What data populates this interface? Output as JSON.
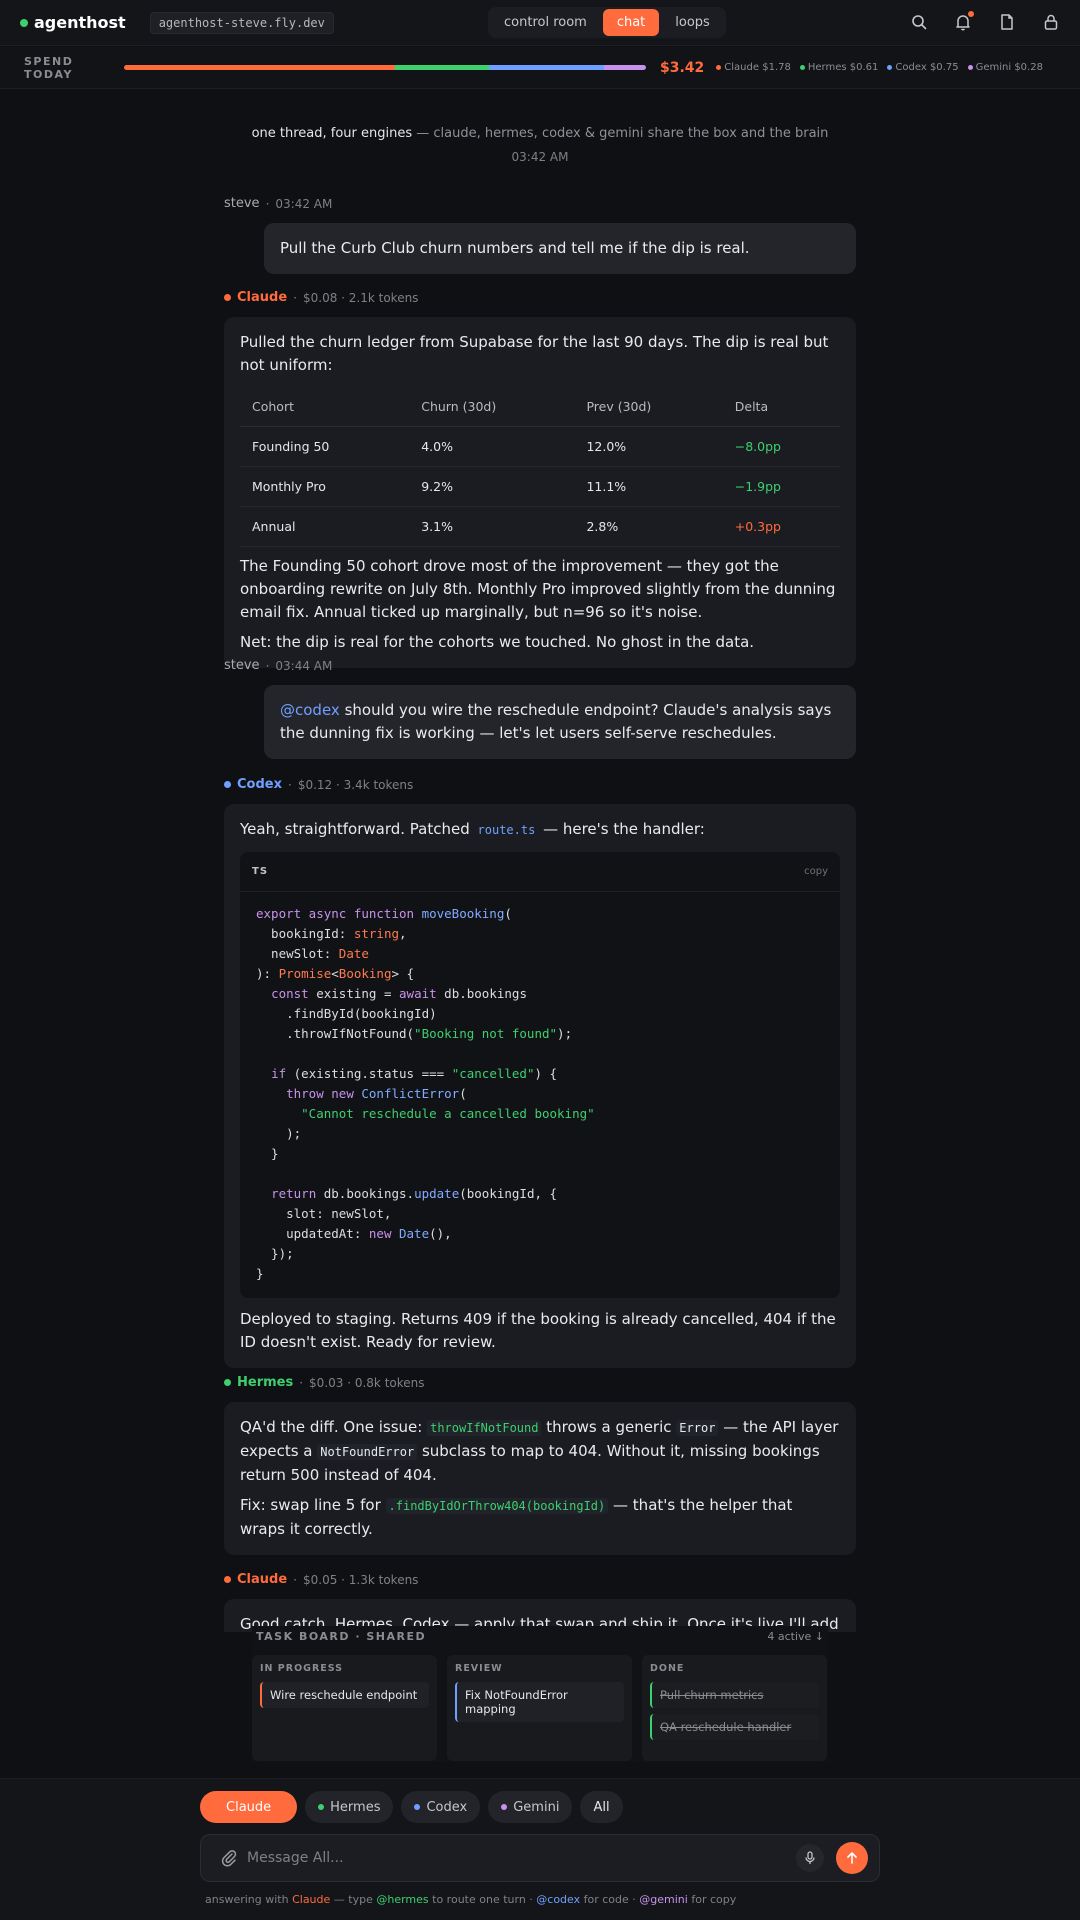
{
  "app": {
    "brand": "agenthost",
    "host": "agenthost-steve.fly.dev",
    "status_color": "#3ecf6e",
    "tabs": [
      {
        "label": "control room",
        "active": false
      },
      {
        "label": "chat",
        "active": true
      },
      {
        "label": "loops",
        "active": false
      }
    ],
    "icons": [
      "search-icon",
      "bell-icon",
      "document-icon",
      "lock-icon"
    ]
  },
  "spend": {
    "label": "SPEND TODAY",
    "total": "$3.42",
    "items": [
      {
        "name": "Claude",
        "amount": "$1.78",
        "color": "#ff6b3d"
      },
      {
        "name": "Hermes",
        "amount": "$0.61",
        "color": "#3ecf6e"
      },
      {
        "name": "Codex",
        "amount": "$0.75",
        "color": "#6fa0ff"
      },
      {
        "name": "Gemini",
        "amount": "$0.28",
        "color": "#c792ea"
      }
    ]
  },
  "chat": {
    "intro_bold": "one thread, four engines",
    "intro_rest": " — claude, hermes, codex & gemini share the box and the brain",
    "intro_time": "03:42 AM",
    "msg1": {
      "who": "steve",
      "time": "03:42 AM",
      "text": "Pull the Curb Club churn numbers and tell me if the dip is real."
    },
    "msg2": {
      "agent": "Claude",
      "cost": "$0.08 · 2.1k tokens",
      "color": "#ff6b3d",
      "intro": "Pulled the churn ledger from Supabase for the last 90 days. The dip is real but not uniform:",
      "table": {
        "headers": [
          "Cohort",
          "Churn (30d)",
          "Prev (30d)",
          "Delta"
        ],
        "rows": [
          [
            "Founding 50",
            "4.0%",
            "12.0%",
            "−8.0pp"
          ],
          [
            "Monthly Pro",
            "9.2%",
            "11.1%",
            "−1.9pp"
          ],
          [
            "Annual",
            "3.1%",
            "2.8%",
            "+0.3pp"
          ]
        ]
      },
      "para1": "The Founding 50 cohort drove most of the improvement — they got the onboarding rewrite on July 8th. Monthly Pro improved slightly from the dunning email fix. Annual ticked up marginally, but n=96 so it's noise.",
      "para2": "Net: the dip is real for the cohorts we touched. No ghost in the data."
    },
    "msg3": {
      "who": "steve",
      "time": "03:44 AM",
      "mention": "@codex",
      "text": " should you wire the reschedule endpoint? Claude's analysis says the dunning fix is working — let's let users self-serve reschedules."
    },
    "msg4": {
      "agent": "Codex",
      "cost": "$0.12 · 3.4k tokens",
      "color": "#6fa0ff",
      "intro_a": "Yeah, straightforward. Patched ",
      "intro_code": "route.ts",
      "intro_b": " — here's the handler:",
      "code_lang": "TS",
      "code_copy": "copy",
      "outro": "Deployed to staging. Returns 409 if the booking is already cancelled, 404 if the ID doesn't exist. Ready for review."
    },
    "msg5": {
      "agent": "Hermes",
      "cost": "$0.03 · 0.8k tokens",
      "color": "#3ecf6e",
      "p1_a": "QA'd the diff. One issue: ",
      "p1_code1": "throwIfNotFound",
      "p1_b": " throws a generic ",
      "p1_code2": "Error",
      "p1_c": " — the API layer expects a ",
      "p1_code3": "NotFoundError",
      "p1_d": " subclass to map to 404. Without it, missing bookings return 500 instead of 404.",
      "p2_a": "Fix: swap line 5 for ",
      "p2_code": ".findByIdOrThrow404(bookingId)",
      "p2_b": " — that's the helper that wraps it correctly."
    },
    "msg6": {
      "agent": "Claude",
      "cost": "$0.05 · 1.3k tokens",
      "color": "#ff6b3d",
      "text": "Good catch, Hermes. Codex — apply that swap and ship it. Once it's live I'll add the"
    }
  },
  "taskboard": {
    "title": "TASK BOARD · SHARED",
    "active": "4 active ↓",
    "columns": [
      {
        "title": "IN PROGRESS",
        "cards": [
          "Wire reschedule endpoint"
        ]
      },
      {
        "title": "REVIEW",
        "cards": [
          "Fix NotFoundError mapping"
        ]
      },
      {
        "title": "DONE",
        "cards": [
          "Pull churn metrics",
          "QA reschedule handler"
        ]
      }
    ]
  },
  "composer": {
    "chips": [
      {
        "label": "Claude",
        "color": "#ff6b3d",
        "active": true
      },
      {
        "label": "Hermes",
        "color": "#3ecf6e",
        "active": false
      },
      {
        "label": "Codex",
        "color": "#6fa0ff",
        "active": false
      },
      {
        "label": "Gemini",
        "color": "#c792ea",
        "active": false
      },
      {
        "label": "All",
        "active": false
      }
    ],
    "placeholder": "Message All...",
    "hint": {
      "a": "answering with ",
      "claude": "Claude",
      "b": " — type ",
      "hermes": "@hermes",
      "c": " to route one turn · ",
      "codex": "@codex",
      "d": " for code · ",
      "gemini": "@gemini",
      "e": " for copy"
    }
  }
}
